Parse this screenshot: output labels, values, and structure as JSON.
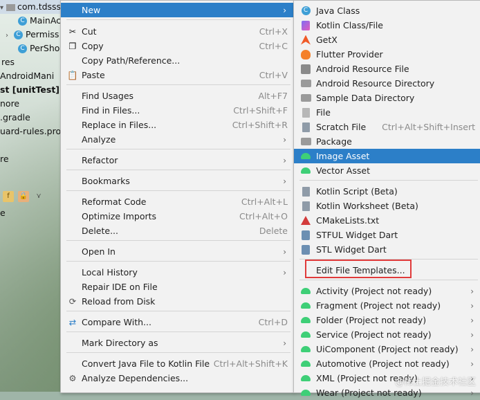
{
  "project_tree": {
    "rows": [
      {
        "label": "com.tdsss",
        "icon": "folder-icon",
        "selected": true
      },
      {
        "label": "MainAc",
        "icon": "class-icon"
      },
      {
        "label": "Permiss",
        "icon": "class-icon"
      },
      {
        "label": "PerSho",
        "icon": "class-icon"
      },
      {
        "label": "res"
      },
      {
        "label": "AndroidMani"
      },
      {
        "label": "st [unitTest]"
      },
      {
        "label": "nore"
      },
      {
        "label": ".gradle"
      },
      {
        "label": "uard-rules.pro"
      },
      {
        "label": "re"
      },
      {
        "label": "e"
      }
    ]
  },
  "context_menu": {
    "items": [
      {
        "label": "New",
        "shortcut": "",
        "submenu": true,
        "icon": "",
        "highlighted": true
      },
      {
        "label": "Cut",
        "shortcut": "Ctrl+X",
        "icon": "scissors-icon"
      },
      {
        "label": "Copy",
        "shortcut": "Ctrl+C",
        "icon": "copy-icon"
      },
      {
        "label": "Copy Path/Reference...",
        "shortcut": ""
      },
      {
        "label": "Paste",
        "shortcut": "Ctrl+V",
        "icon": "paste-icon"
      },
      {
        "label": "Find Usages",
        "shortcut": "Alt+F7"
      },
      {
        "label": "Find in Files...",
        "shortcut": "Ctrl+Shift+F"
      },
      {
        "label": "Replace in Files...",
        "shortcut": "Ctrl+Shift+R"
      },
      {
        "label": "Analyze",
        "shortcut": "",
        "submenu": true
      },
      {
        "label": "Refactor",
        "shortcut": "",
        "submenu": true
      },
      {
        "label": "Bookmarks",
        "shortcut": "",
        "submenu": true
      },
      {
        "label": "Reformat Code",
        "shortcut": "Ctrl+Alt+L"
      },
      {
        "label": "Optimize Imports",
        "shortcut": "Ctrl+Alt+O"
      },
      {
        "label": "Delete...",
        "shortcut": "Delete"
      },
      {
        "label": "Open In",
        "shortcut": "",
        "submenu": true
      },
      {
        "label": "Local History",
        "shortcut": "",
        "submenu": true
      },
      {
        "label": "Repair IDE on File",
        "shortcut": ""
      },
      {
        "label": "Reload from Disk",
        "shortcut": "",
        "icon": "reload-icon"
      },
      {
        "label": "Compare With...",
        "shortcut": "Ctrl+D",
        "icon": "compare-icon"
      },
      {
        "label": "Mark Directory as",
        "shortcut": "",
        "submenu": true
      },
      {
        "label": "Convert Java File to Kotlin File",
        "shortcut": "Ctrl+Alt+Shift+K"
      },
      {
        "label": "Analyze Dependencies...",
        "shortcut": "",
        "icon": "dependencies-icon"
      }
    ]
  },
  "new_submenu": {
    "items": [
      {
        "label": "Java Class",
        "icon": "java-class-icon"
      },
      {
        "label": "Kotlin Class/File",
        "icon": "kotlin-icon"
      },
      {
        "label": "GetX",
        "icon": "getx-icon"
      },
      {
        "label": "Flutter Provider",
        "icon": "flutter-icon"
      },
      {
        "label": "Android Resource File",
        "icon": "resource-file-icon"
      },
      {
        "label": "Android Resource Directory",
        "icon": "folder-icon"
      },
      {
        "label": "Sample Data Directory",
        "icon": "folder-icon"
      },
      {
        "label": "File",
        "icon": "file-icon"
      },
      {
        "label": "Scratch File",
        "shortcut": "Ctrl+Alt+Shift+Insert",
        "icon": "scratch-icon"
      },
      {
        "label": "Package",
        "icon": "package-icon"
      },
      {
        "label": "Image Asset",
        "icon": "android-icon",
        "highlighted": true
      },
      {
        "label": "Vector Asset",
        "icon": "android-icon"
      },
      {
        "label": "Kotlin Script (Beta)",
        "icon": "kotlin-script-icon"
      },
      {
        "label": "Kotlin Worksheet (Beta)",
        "icon": "kotlin-worksheet-icon"
      },
      {
        "label": "CMakeLists.txt",
        "icon": "cmake-icon"
      },
      {
        "label": "STFUL Widget Dart",
        "icon": "dart-icon"
      },
      {
        "label": "STL Widget Dart",
        "icon": "dart-icon"
      },
      {
        "label": "Edit File Templates...",
        "icon": ""
      },
      {
        "label": "Activity (Project not ready)",
        "icon": "android-icon",
        "submenu": true
      },
      {
        "label": "Fragment (Project not ready)",
        "icon": "android-icon",
        "submenu": true
      },
      {
        "label": "Folder (Project not ready)",
        "icon": "android-icon",
        "submenu": true
      },
      {
        "label": "Service (Project not ready)",
        "icon": "android-icon",
        "submenu": true
      },
      {
        "label": "UiComponent (Project not ready)",
        "icon": "android-icon",
        "submenu": true
      },
      {
        "label": "Automotive (Project not ready)",
        "icon": "android-icon",
        "submenu": true
      },
      {
        "label": "XML (Project not ready)",
        "icon": "android-icon",
        "submenu": true
      },
      {
        "label": "Wear (Project not ready)",
        "icon": "android-icon",
        "submenu": true
      }
    ]
  },
  "watermark": "@稀土掘金技术社区",
  "colors": {
    "highlight": "#2c7fc8",
    "annotation_box": "#e03a3a",
    "menu_bg": "#f2f2f2"
  }
}
